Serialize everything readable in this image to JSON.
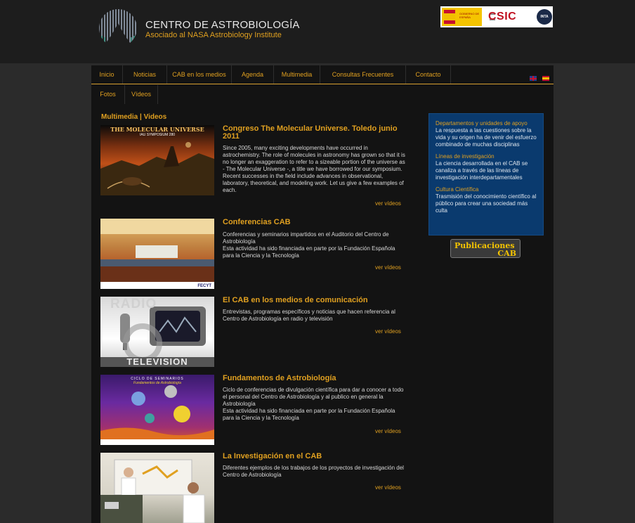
{
  "header": {
    "title": "CENTRO DE ASTROBIOLOGÍA",
    "subtitle": "Asociado al NASA Astrobiology Institute",
    "partners": {
      "gob_label": "GOBIERNO DE ESPAÑA",
      "csic_label": "CSIC",
      "inta_label": "INTA"
    }
  },
  "nav": [
    "Inicio",
    "Noticias",
    "CAB en los medios",
    "Agenda",
    "Multimedia",
    "Consultas Frecuentes",
    "Contacto"
  ],
  "subnav": [
    "Fotos",
    "Vídeos"
  ],
  "section_title": "Multimedia | Videos",
  "items": [
    {
      "title": "Congreso The Molecular Universe. Toledo junio 2011",
      "thumb_title": "THE MOLECULAR UNIVERSE",
      "thumb_sub": "IAU SYMPOSIUM 280",
      "description": "Since 2005, many exciting developments have occurred in astrochemistry. The role of molecules in astronomy has grown so that it is no longer an exaggeration to refer to a sizeable portion of the universe as - The Molecular Universe -, a title we have borrowed for our symposium. Recent successes in the field include advances in observational, laboratory, theoretical, and modeling work. Let us give a few examples of each.",
      "more": "ver vídeos"
    },
    {
      "title": "Conferencias CAB",
      "description": "Conferencias y seminarios impartidos en el Auditorio del Centro de Astrobiología\nEsta actividad ha sido financiada en parte por la Fundación Española para la Ciencia y la Tecnología",
      "thumb_logos": "FECYT",
      "more": "ver vídeos"
    },
    {
      "title": "El CAB en los medios de comunicación",
      "thumb_top": "RADIO",
      "thumb_bottom": "TELEVISION",
      "description": "Entrevistas, programas específicos y noticias que hacen referencia al Centro de Astrobiología en radio y televisión",
      "more": "ver vídeos"
    },
    {
      "title": "Fundamentos de Astrobiología",
      "thumb_title": "CICLO DE SEMINARIOS",
      "thumb_sub": "Fundamentos de Astrobiología",
      "description": "Ciclo de conferencias de divulgación científica para dar a conocer a todo el personal del Centro de Astrobiología y al publico en general la Astrobiología\nEsta actividad ha sido financiada en parte por la Fundación Española para la Ciencia y la Tecnología",
      "more": "ver vídeos"
    },
    {
      "title": "La Investigación en el CAB",
      "description": "Diferentes ejemplos de los trabajos de los proyectos de investigación del Centro de Astrobiología",
      "more": "ver vídeos"
    }
  ],
  "sidebar": [
    {
      "title": "Departamentos y unidades de apoyo",
      "text": "La respuesta a las cuestiones sobre la vida y su origen ha de venir del esfuerzo combinado de muchas disciplinas"
    },
    {
      "title": "Líneas de investigación",
      "text": "La ciencia desarrollada en el CAB se canaliza a través de las líneas de investigación interdepartamentales"
    },
    {
      "title": "Cultura Científica",
      "text": "Trasmisión del conocimiento científico al público para crear una sociedad más culta"
    }
  ],
  "publications": {
    "line1": "Publicaciones",
    "line2": "CAB"
  },
  "colors": {
    "accent": "#e0a020",
    "background": "#131313",
    "sidebar": "#0a3a6e"
  }
}
